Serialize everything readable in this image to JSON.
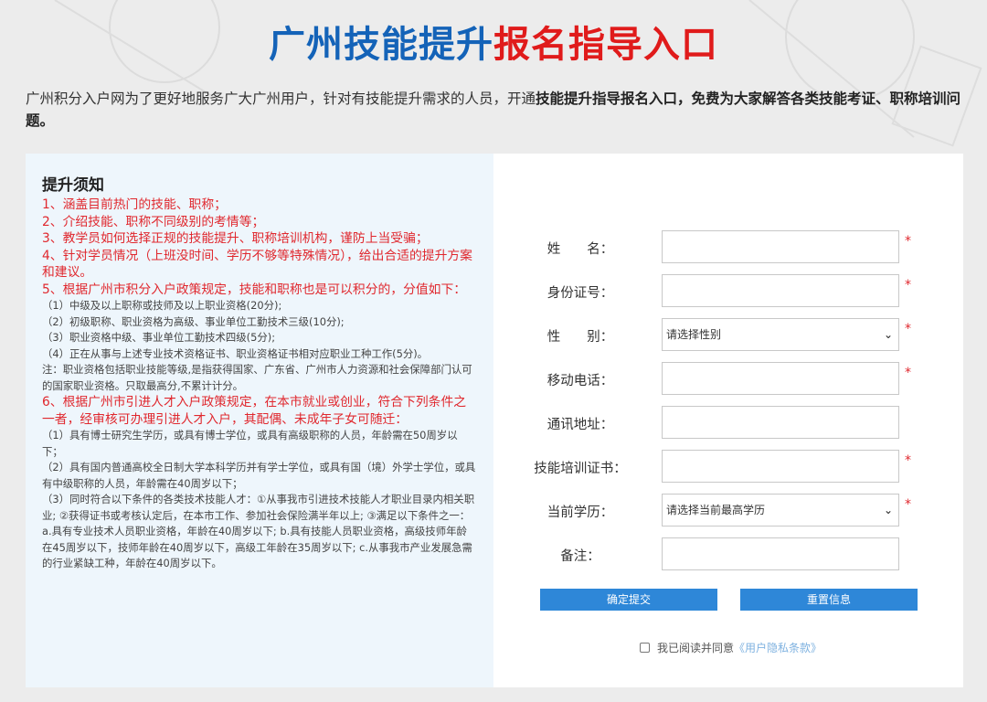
{
  "header": {
    "title_blue": "广州技能提升",
    "title_red": "报名指导入口"
  },
  "intro": {
    "text_plain": "广州积分入户网为了更好地服务广大广州用户，针对有技能提升需求的人员，开通",
    "text_bold": "技能提升指导报名入口，免费为大家解答各类技能考证、职称培训问题。"
  },
  "notice": {
    "title": "提升须知",
    "items": [
      {
        "style": "red",
        "text": "1、涵盖目前热门的技能、职称；"
      },
      {
        "style": "red",
        "text": "2、介绍技能、职称不同级别的考情等；"
      },
      {
        "style": "red",
        "text": "3、教学员如何选择正规的技能提升、职称培训机构，谨防上当受骗；"
      },
      {
        "style": "red",
        "text": "4、针对学员情况（上班没时间、学历不够等特殊情况），给出合适的提升方案和建议。"
      },
      {
        "style": "red",
        "text": "5、根据广州市积分入户政策规定，技能和职称也是可以积分的，分值如下："
      },
      {
        "style": "gray",
        "text": "（1）中级及以上职称或技师及以上职业资格(20分);"
      },
      {
        "style": "gray",
        "text": "（2）初级职称、职业资格为高级、事业单位工勤技术三级(10分);"
      },
      {
        "style": "gray",
        "text": "（3）职业资格中级、事业单位工勤技术四级(5分);"
      },
      {
        "style": "gray",
        "text": "（4）正在从事与上述专业技术资格证书、职业资格证书相对应职业工种工作(5分)。"
      },
      {
        "style": "gray",
        "text": "注：职业资格包括职业技能等级,是指获得国家、广东省、广州市人力资源和社会保障部门认可的国家职业资格。只取最高分,不累计计分。"
      },
      {
        "style": "red",
        "text": "6、根据广州市引进人才入户政策规定，在本市就业或创业，符合下列条件之一者，经审核可办理引进人才入户，其配偶、未成年子女可随迁："
      },
      {
        "style": "gray",
        "text": "（1）具有博士研究生学历，或具有博士学位，或具有高级职称的人员，年龄需在50周岁以下；"
      },
      {
        "style": "gray",
        "text": "（2）具有国内普通高校全日制大学本科学历并有学士学位，或具有国（境）外学士学位，或具有中级职称的人员，年龄需在40周岁以下；"
      },
      {
        "style": "gray",
        "text": "（3）同时符合以下条件的各类技术技能人才：①从事我市引进技术技能人才职业目录内相关职业; ②获得证书或考核认定后，在本市工作、参加社会保险满半年以上; ③满足以下条件之一： a.具有专业技术人员职业资格，年龄在40周岁以下; b.具有技能人员职业资格，高级技师年龄在45周岁以下，技师年龄在40周岁以下，高级工年龄在35周岁以下; c.从事我市产业发展急需的行业紧缺工种，年龄在40周岁以下。"
      }
    ]
  },
  "form": {
    "name_label": "姓　　名：",
    "id_label": "身份证号：",
    "gender_label": "性　　别：",
    "gender_value": "请选择性别",
    "phone_label": "移动电话：",
    "address_label": "通讯地址：",
    "cert_label": "技能培训证书：",
    "edu_label": "当前学历：",
    "edu_value": "请选择当前最高学历",
    "note_label": "备注：",
    "required_mark": "*",
    "submit_label": "确定提交",
    "reset_label": "重置信息",
    "agree_text": "我已阅读并同意",
    "agree_link": "《用户隐私条款》"
  },
  "colors": {
    "title_blue": "#1463b8",
    "title_red": "#e01b1b",
    "notice_red": "#e0282e",
    "button_blue": "#2e87d8",
    "left_panel_bg": "#eef6fc"
  }
}
